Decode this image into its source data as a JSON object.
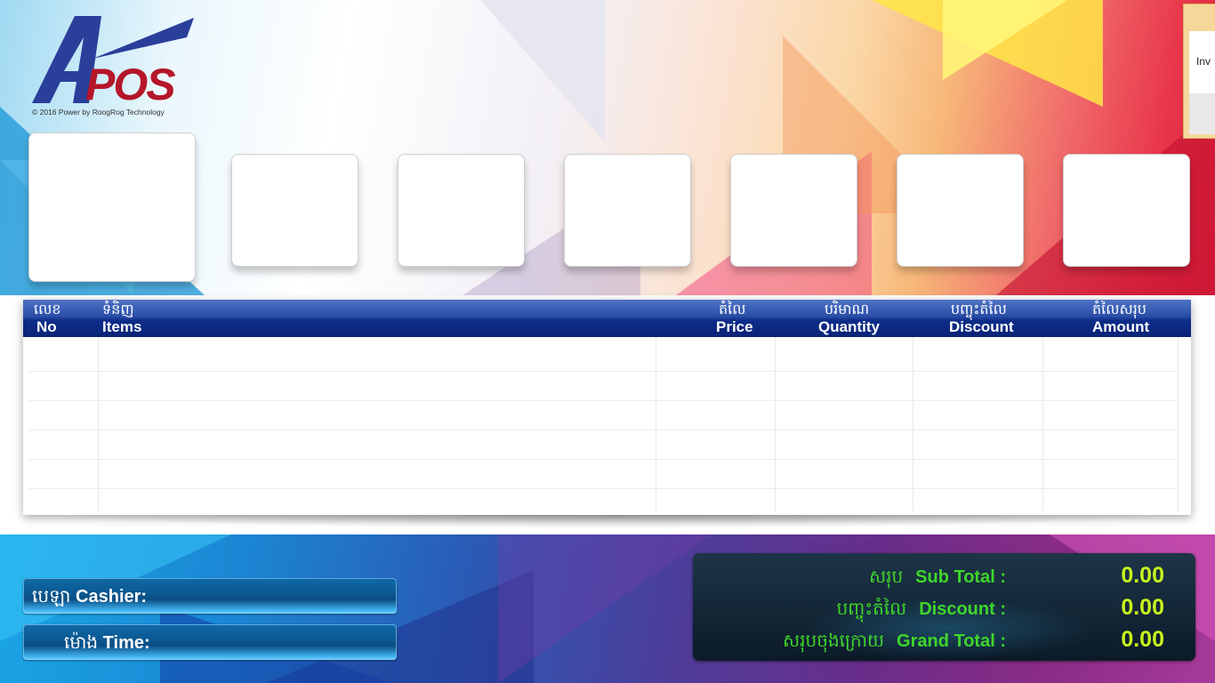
{
  "logo": {
    "text": "APOS",
    "copyright": "© 2016 Power by RoogRog Technology"
  },
  "invoice_window": {
    "label": "Inv"
  },
  "grid": {
    "columns": [
      {
        "km": "លេខ",
        "en": "No"
      },
      {
        "km": "ទំនិញ",
        "en": "Items"
      },
      {
        "km": "តំលៃ",
        "en": "Price"
      },
      {
        "km": "បរិមាណ",
        "en": "Quantity"
      },
      {
        "km": "បញ្ចុះតំលៃ",
        "en": "Discount"
      },
      {
        "km": "តំលៃសរុប",
        "en": "Amount"
      }
    ],
    "rows": []
  },
  "info": {
    "cashier_km": "បេឡា",
    "cashier_en": "Cashier:",
    "time_km": "ម៉ោង",
    "time_en": "Time:"
  },
  "totals": {
    "subtotal_km": "សរុប",
    "subtotal_en": "Sub Total :",
    "subtotal_value": "0.00",
    "discount_km": "បញ្ចុះតំលៃ",
    "discount_en": "Discount :",
    "discount_value": "0.00",
    "grand_km": "សរុបចុងក្រោយ",
    "grand_en": "Grand Total :",
    "grand_value": "0.00"
  },
  "colors": {
    "header_blue": "#0d2d8a",
    "total_green": "#3fd62b",
    "value_yellowgreen": "#c8f21d",
    "logo_blue": "#2a3f9a",
    "logo_red": "#b5162a"
  }
}
